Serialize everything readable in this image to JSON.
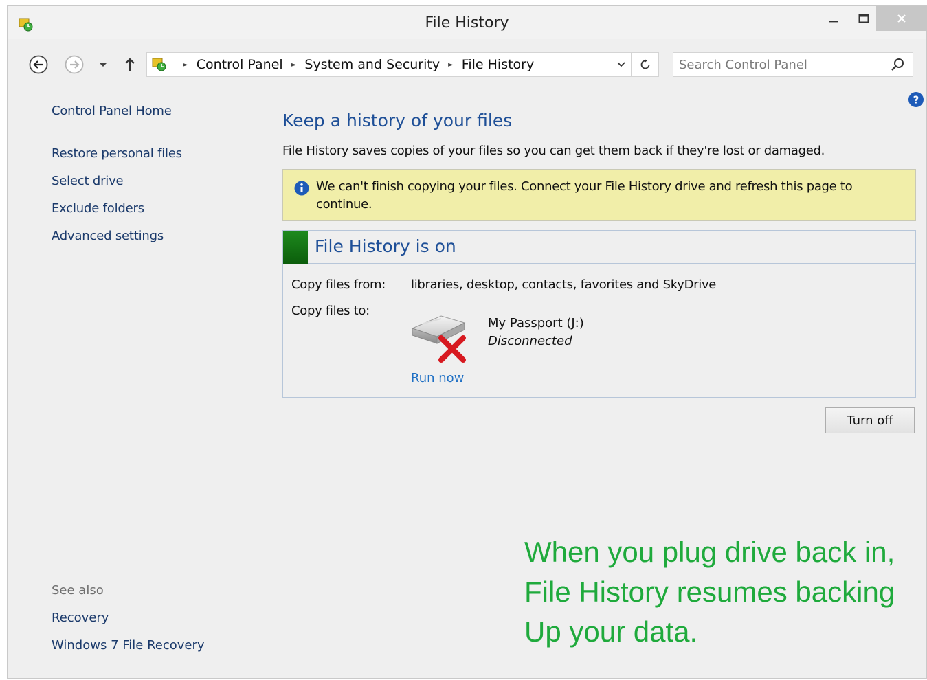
{
  "window": {
    "title": "File History",
    "controls": {
      "minimize": "–",
      "maximize": "☐",
      "close": "✕"
    }
  },
  "addressbar": {
    "crumbs": [
      "Control Panel",
      "System and Security",
      "File History"
    ]
  },
  "search": {
    "placeholder": "Search Control Panel"
  },
  "leftnav": {
    "home": "Control Panel Home",
    "items": [
      "Restore personal files",
      "Select drive",
      "Exclude folders",
      "Advanced settings"
    ],
    "see_also_label": "See also",
    "see_also_links": [
      "Recovery",
      "Windows 7 File Recovery"
    ]
  },
  "main": {
    "title": "Keep a history of your files",
    "description": "File History saves copies of your files so you can get them back if they're lost or damaged.",
    "warning": "We can't finish copying your files. Connect your File History drive and refresh this page to continue.",
    "status": {
      "title": "File History is on",
      "copy_from_label": "Copy files from:",
      "copy_from_value": "libraries, desktop, contacts, favorites and SkyDrive",
      "copy_to_label": "Copy files to:",
      "drive_name": "My Passport (J:)",
      "drive_status": "Disconnected",
      "run_now": "Run now"
    },
    "turn_off_label": "Turn off"
  },
  "annotation": {
    "lines": [
      "When you plug drive back in,",
      "File History resumes backing",
      "Up your data."
    ]
  },
  "colors": {
    "link": "#1b3a6b",
    "heading": "#1e4f97",
    "warning_bg": "#f1eea9",
    "status_green": "#1e8a1e",
    "annotation": "#1faa3c"
  }
}
